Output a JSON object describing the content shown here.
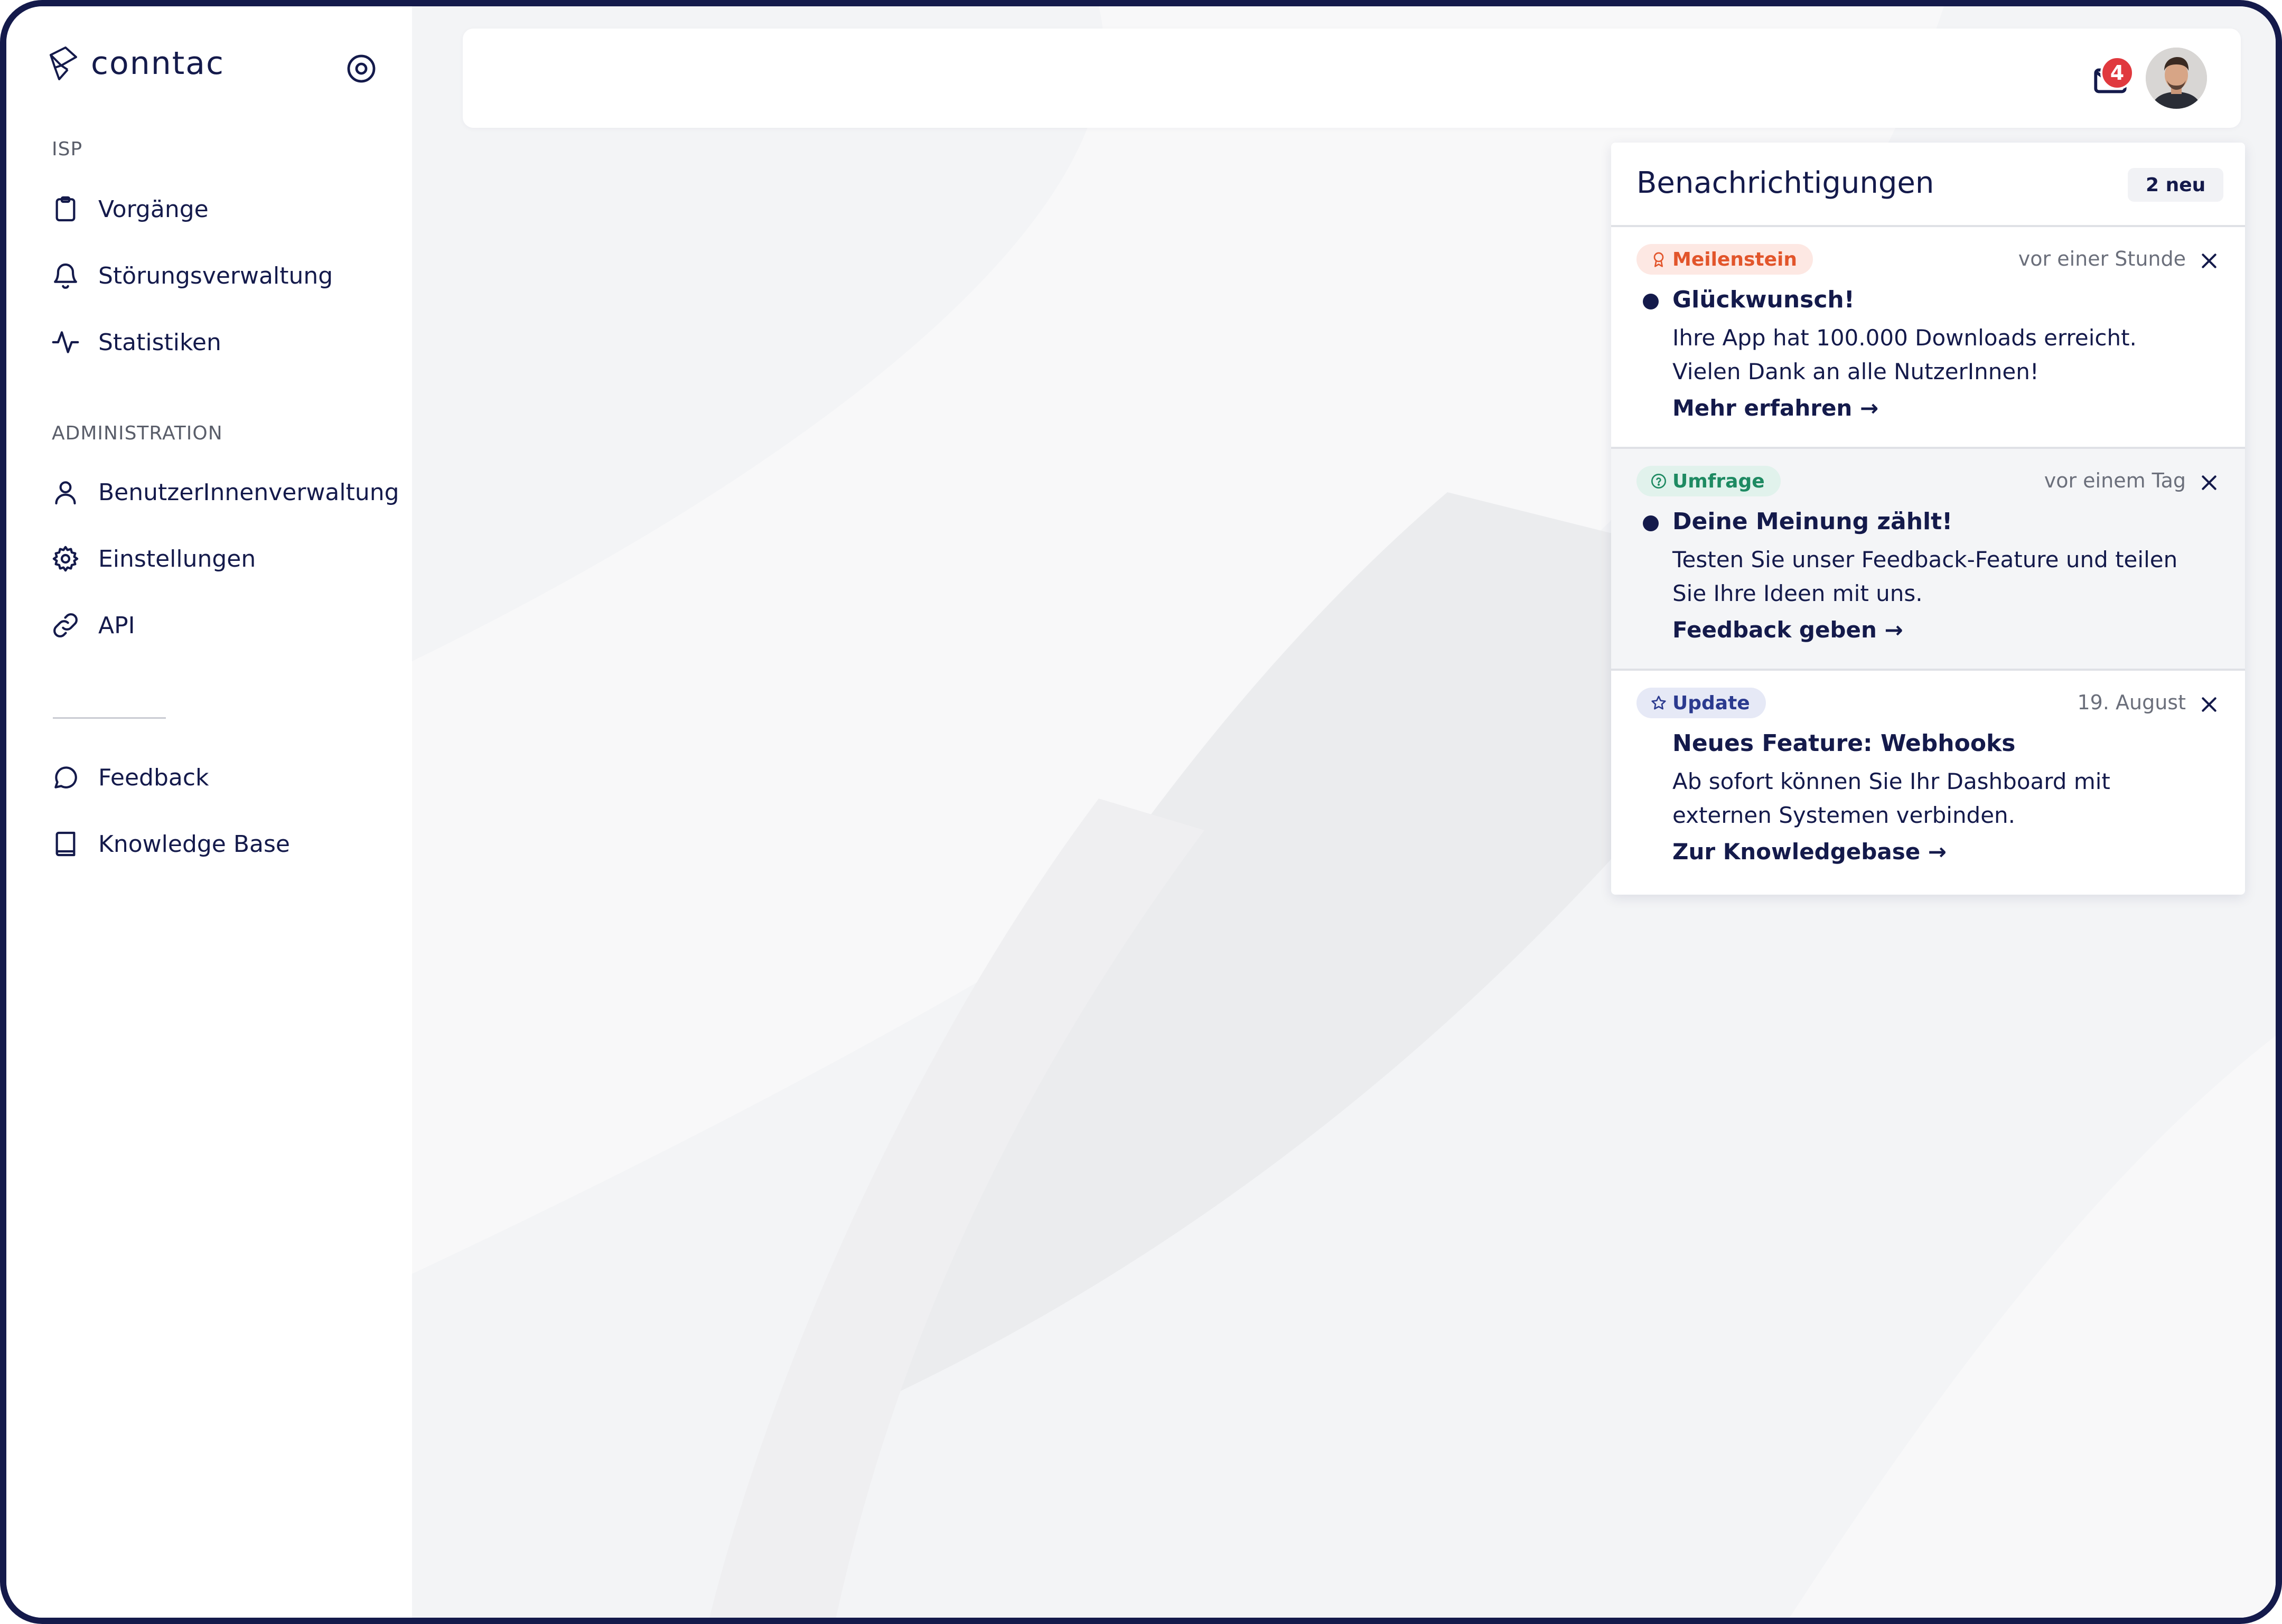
{
  "brand": {
    "name": "conntac"
  },
  "sidebar": {
    "section_isp": "ISP",
    "isp_items": [
      {
        "label": "Vorgänge",
        "icon": "clipboard-icon"
      },
      {
        "label": "Störungsverwaltung",
        "icon": "bell-icon"
      },
      {
        "label": "Statistiken",
        "icon": "activity-icon"
      }
    ],
    "section_admin": "ADMINISTRATION",
    "admin_items": [
      {
        "label": "BenutzerInnenverwaltung",
        "icon": "user-icon"
      },
      {
        "label": "Einstellungen",
        "icon": "gear-icon"
      },
      {
        "label": "API",
        "icon": "link-icon"
      }
    ],
    "bottom_items": [
      {
        "label": "Feedback",
        "icon": "chat-bubble-icon"
      },
      {
        "label": "Knowledge Base",
        "icon": "book-icon"
      }
    ]
  },
  "topbar": {
    "unread_count": "4"
  },
  "notifications": {
    "title": "Benachrichtigungen",
    "new_label": "2 neu",
    "items": [
      {
        "tag": "Meilenstein",
        "time": "vor einer Stunde",
        "title": "Glückwunsch!",
        "body_line1": "Ihre App hat 100.000 Downloads erreicht.",
        "body_line2": "Vielen Dank an alle NutzerInnen!",
        "link": "Mehr erfahren →",
        "unread": true
      },
      {
        "tag": "Umfrage",
        "time": "vor einem Tag",
        "title": "Deine Meinung zählt!",
        "body_line1": "Testen Sie unser Feedback-Feature und teilen",
        "body_line2": "Sie Ihre Ideen mit uns.",
        "link": "Feedback geben →",
        "unread": true
      },
      {
        "tag": "Update",
        "time": "19. August",
        "title": "Neues Feature: Webhooks",
        "body_line1": "Ab sofort können Sie Ihr Dashboard mit",
        "body_line2": "externen Systemen verbinden.",
        "link": "Zur Knowledgebase →",
        "unread": false
      }
    ]
  },
  "colors": {
    "navy": "#141a4b",
    "badge_red": "#e0393e",
    "milestone_orange": "#e2552b",
    "survey_green": "#1e8a62",
    "update_blue": "#2b3a8f"
  }
}
